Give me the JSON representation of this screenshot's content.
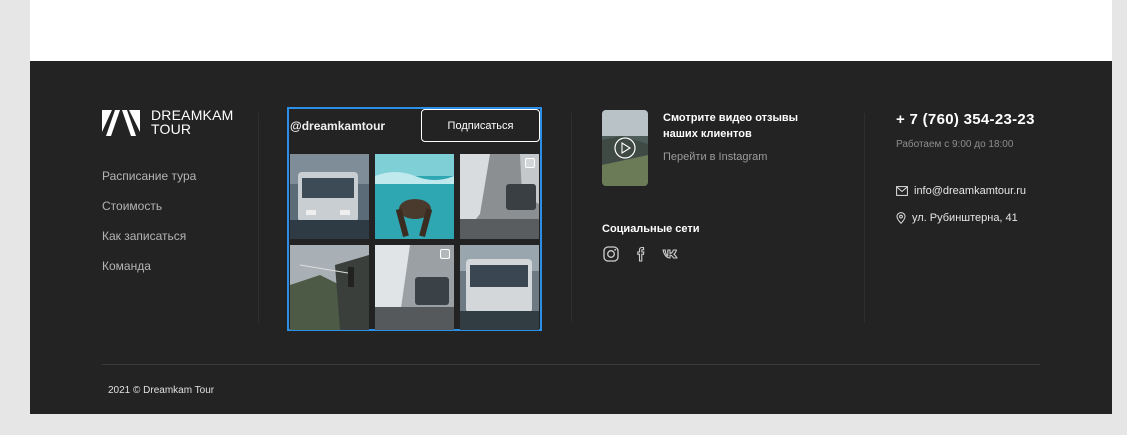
{
  "logo": {
    "line1": "DREAMKAM",
    "line2": "TOUR"
  },
  "nav": [
    {
      "label": "Расписание тура"
    },
    {
      "label": "Стоимость"
    },
    {
      "label": "Как записаться"
    },
    {
      "label": "Команда"
    }
  ],
  "instagram": {
    "handle": "@dreamkamtour",
    "subscribe_label": "Подписаться",
    "tiles": [
      {
        "subject": "bus"
      },
      {
        "subject": "underwater"
      },
      {
        "subject": "snow-road"
      },
      {
        "subject": "cliff"
      },
      {
        "subject": "snow-truck"
      },
      {
        "subject": "bus"
      }
    ]
  },
  "video": {
    "title": "Смотрите видео отзывы наших клиентов",
    "link": "Перейти в Instagram",
    "icon": "play-icon"
  },
  "social": {
    "title": "Социальные сети",
    "icons": [
      "instagram-icon",
      "facebook-icon",
      "vk-icon"
    ]
  },
  "contacts": {
    "phone": "+ 7 (760) 354-23-23",
    "hours": "Работаем с 9:00 до 18:00",
    "email": "info@dreamkamtour.ru",
    "address": "ул. Рубинштерна, 41"
  },
  "copyright": "2021 © Dreamkam Tour",
  "colors": {
    "footer_bg": "#232323",
    "accent_border": "#2b8fe8",
    "page_bg": "#e6e6e6"
  }
}
